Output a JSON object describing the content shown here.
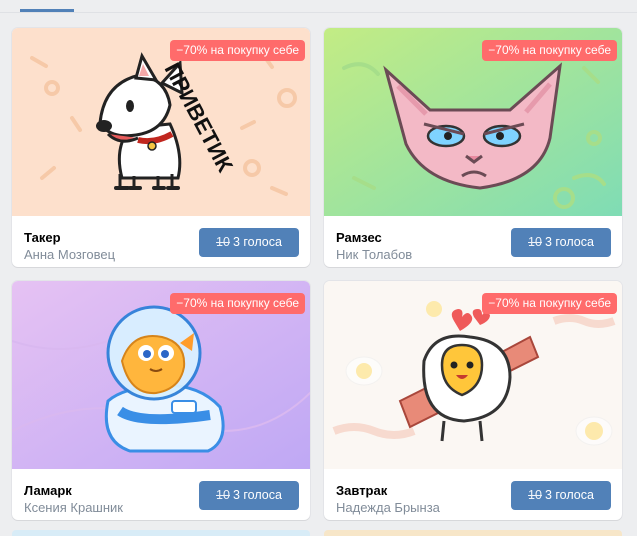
{
  "stickers": [
    {
      "name": "Такер",
      "author": "Анна Мозговец",
      "badge": "−70% на покупку себе",
      "old_price": "10",
      "new_price": "3 голоса",
      "speech": "ПРИВЕТИК"
    },
    {
      "name": "Рамзес",
      "author": "Ник Толабов",
      "badge": "−70% на покупку себе",
      "old_price": "10",
      "new_price": "3 голоса"
    },
    {
      "name": "Ламарк",
      "author": "Ксения Крашник",
      "badge": "−70% на покупку себе",
      "old_price": "10",
      "new_price": "3 голоса"
    },
    {
      "name": "Завтрак",
      "author": "Надежда Брынза",
      "badge": "−70% на покупку себе",
      "old_price": "10",
      "new_price": "3 голоса"
    }
  ],
  "colors": {
    "accent": "#5181b8",
    "badge": "#ff6b6b",
    "muted": "#818c99"
  }
}
